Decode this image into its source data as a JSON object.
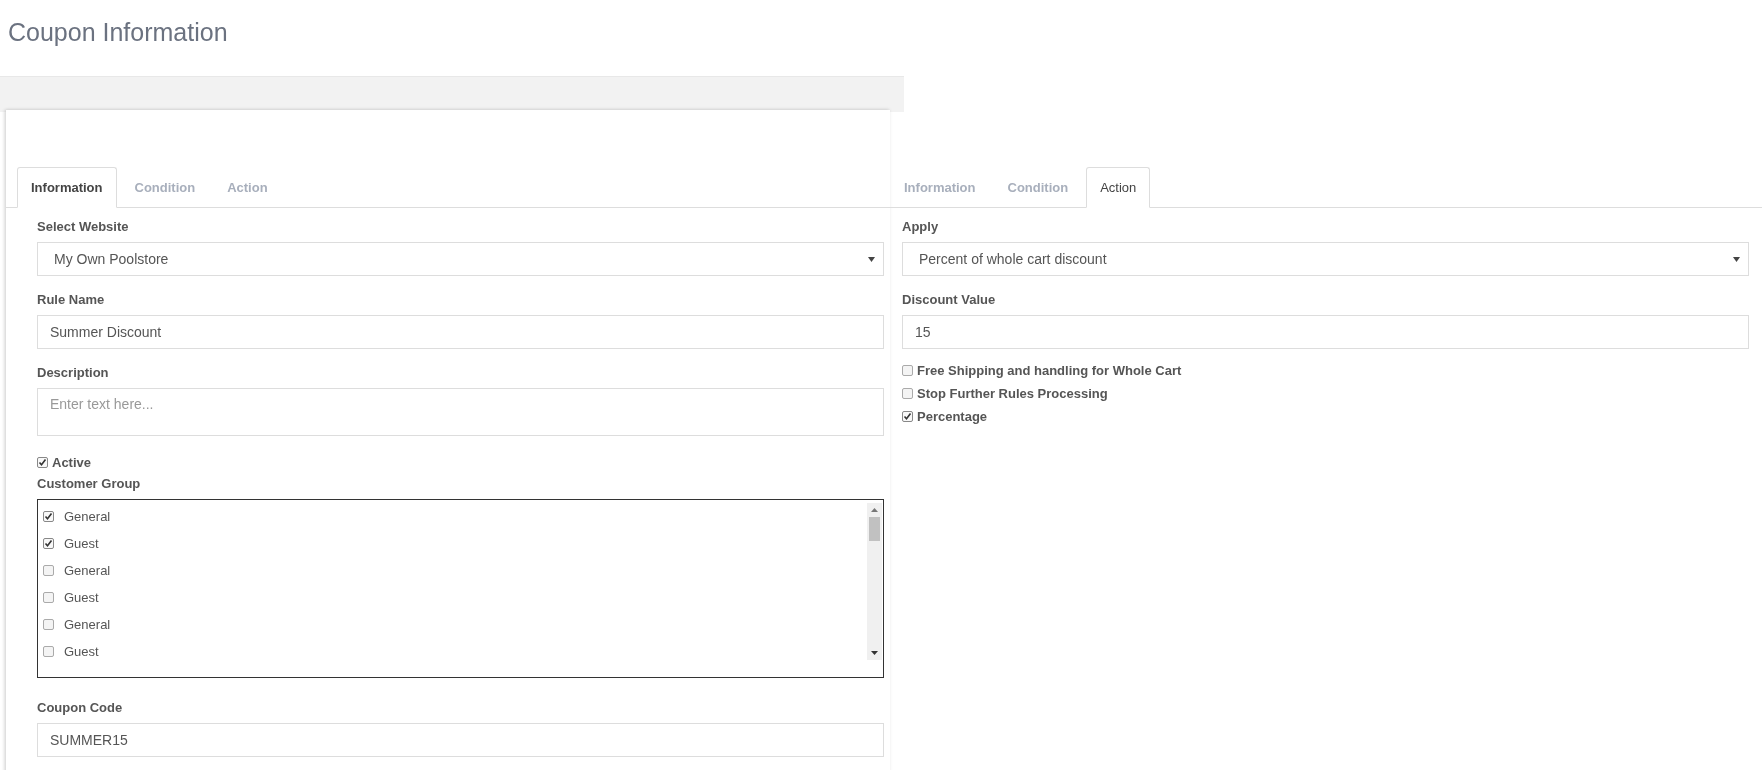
{
  "page_title": "Coupon Information",
  "left_panel": {
    "tabs": [
      {
        "label": "Information",
        "selected": true
      },
      {
        "label": "Condition",
        "selected": false
      },
      {
        "label": "Action",
        "selected": false
      }
    ],
    "select_website": {
      "label": "Select Website",
      "value": "My Own Poolstore"
    },
    "rule_name": {
      "label": "Rule Name",
      "value": "Summer Discount"
    },
    "description": {
      "label": "Description",
      "placeholder": "Enter text here..."
    },
    "active": {
      "label": "Active",
      "checked": true
    },
    "customer_group": {
      "label": "Customer Group",
      "items": [
        {
          "label": "General",
          "checked": true
        },
        {
          "label": "Guest",
          "checked": true
        },
        {
          "label": "General",
          "checked": false
        },
        {
          "label": "Guest",
          "checked": false
        },
        {
          "label": "General",
          "checked": false
        },
        {
          "label": "Guest",
          "checked": false
        }
      ]
    },
    "coupon_code": {
      "label": "Coupon Code",
      "value": "SUMMER15"
    }
  },
  "right_panel": {
    "tabs": [
      {
        "label": "Information",
        "selected": false
      },
      {
        "label": "Condition",
        "selected": false
      },
      {
        "label": "Action",
        "selected": true
      }
    ],
    "apply": {
      "label": "Apply",
      "value": "Percent of whole cart discount"
    },
    "discount_value": {
      "label": "Discount Value",
      "value": "15"
    },
    "options": [
      {
        "label": "Free Shipping and handling for Whole Cart",
        "checked": false
      },
      {
        "label": "Stop Further Rules Processing",
        "checked": false
      },
      {
        "label": "Percentage",
        "checked": true
      }
    ]
  }
}
